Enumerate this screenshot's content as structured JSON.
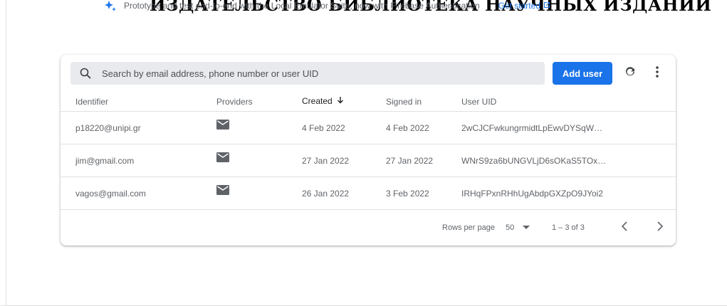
{
  "banner": {
    "text": "Prototype and test end-to-end with the Local Emulator Suite, now with Firebase Authentication",
    "link_label": "Get started",
    "overflow_text": "ИЗДАТЕЛЬСТВО БИБЛИОТЕКА НАУЧНЫХ ИЗДАНИЙ"
  },
  "search": {
    "placeholder": "Search by email address, phone number or user UID"
  },
  "toolbar": {
    "add_user_label": "Add user"
  },
  "table": {
    "headers": {
      "identifier": "Identifier",
      "providers": "Providers",
      "created": "Created",
      "signed_in": "Signed in",
      "user_uid": "User UID"
    },
    "rows": [
      {
        "identifier": "p18220@unipi.gr",
        "provider": "mail-icon",
        "created": "4 Feb 2022",
        "signed_in": "4 Feb 2022",
        "uid": "2wCJCFwkungrmidtLpEwvDYSqW…"
      },
      {
        "identifier": "jim@gmail.com",
        "provider": "mail-icon",
        "created": "27 Jan 2022",
        "signed_in": "27 Jan 2022",
        "uid": "WNrS9za6bUNGVLjD6sOKaS5TOx…"
      },
      {
        "identifier": "vagos@gmail.com",
        "provider": "mail-icon",
        "created": "26 Jan 2022",
        "signed_in": "3 Feb 2022",
        "uid": "IRHqFPxnRHhUgAbdpGXZpO9JYoi2"
      }
    ]
  },
  "pagination": {
    "rows_per_page_label": "Rows per page",
    "rows_per_page_value": "50",
    "range": "1 – 3 of 3"
  },
  "colors": {
    "accent": "#1a73e8",
    "search_bg": "#e8eaed",
    "divider": "#e0e0e0"
  }
}
